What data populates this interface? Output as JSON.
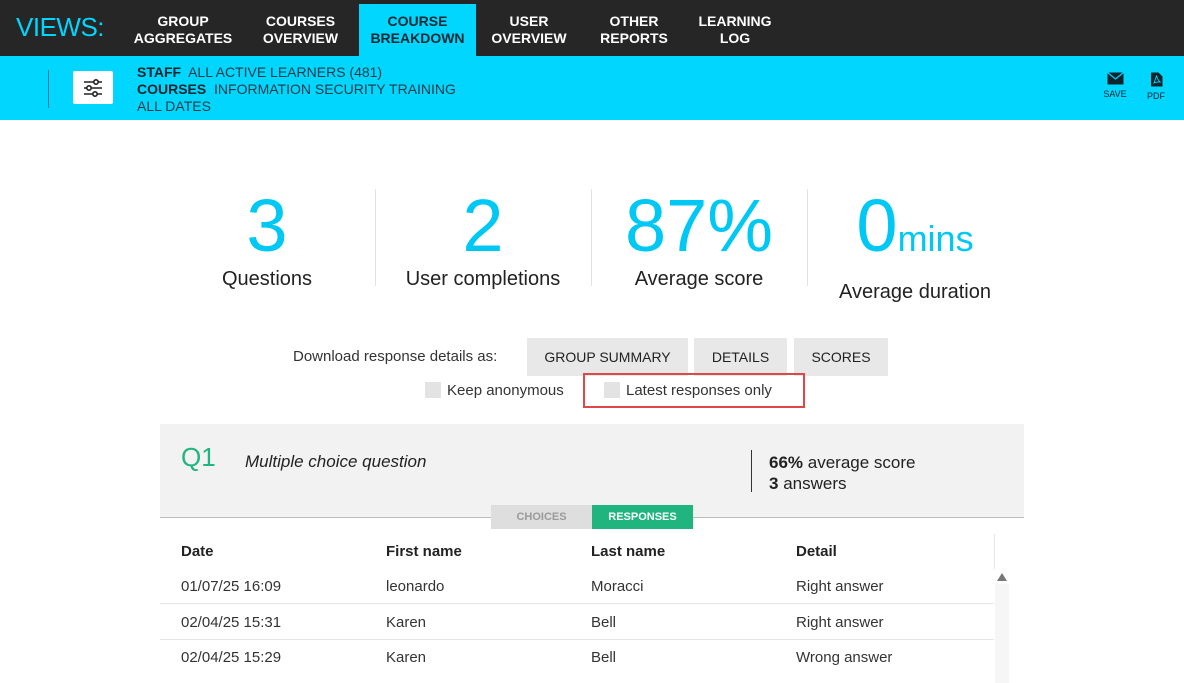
{
  "nav": {
    "views_label": "VIEWS:",
    "items": [
      {
        "line1": "GROUP",
        "line2": "AGGREGATES"
      },
      {
        "line1": "COURSES",
        "line2": "OVERVIEW"
      },
      {
        "line1": "COURSE",
        "line2": "BREAKDOWN"
      },
      {
        "line1": "USER",
        "line2": "OVERVIEW"
      },
      {
        "line1": "OTHER",
        "line2": "REPORTS"
      },
      {
        "line1": "LEARNING",
        "line2": "LOG"
      }
    ],
    "active_index": 2
  },
  "filters": {
    "staff_key": "STAFF",
    "staff_value": "ALL ACTIVE LEARNERS (481)",
    "courses_key": "COURSES",
    "courses_value": "INFORMATION SECURITY TRAINING",
    "dates_value": "ALL DATES",
    "save_label": "SAVE",
    "pdf_label": "PDF",
    "filter_icon": "sliders-icon",
    "save_icon": "envelope-icon",
    "pdf_icon": "pdf-file-icon"
  },
  "stats": [
    {
      "value": "3",
      "unit": "",
      "label": "Questions"
    },
    {
      "value": "2",
      "unit": "",
      "label": "User completions"
    },
    {
      "value": "87%",
      "unit": "",
      "label": "Average score"
    },
    {
      "value": "0",
      "unit": "mins",
      "label": "Average duration"
    }
  ],
  "download": {
    "label": "Download response details as:",
    "buttons": [
      "GROUP SUMMARY",
      "DETAILS",
      "SCORES"
    ],
    "keep_anonymous": "Keep anonymous",
    "latest_only": "Latest responses only"
  },
  "question": {
    "number": "Q1",
    "type": "Multiple choice question",
    "avg_score_value": "66%",
    "avg_score_text": "average score",
    "answers_value": "3",
    "answers_text": "answers",
    "tabs": [
      "CHOICES",
      "RESPONSES"
    ],
    "active_tab": "RESPONSES"
  },
  "table": {
    "columns": [
      "Date",
      "First name",
      "Last name",
      "Detail"
    ],
    "rows": [
      [
        "01/07/25 16:09",
        "leonardo",
        "Moracci",
        "Right answer"
      ],
      [
        "02/04/25 15:31",
        "Karen",
        "Bell",
        "Right answer"
      ],
      [
        "02/04/25 15:29",
        "Karen",
        "Bell",
        "Wrong answer"
      ]
    ]
  },
  "colors": {
    "accent": "#00d6ff",
    "nav_bg": "#262626",
    "stat": "#00c8f5",
    "green": "#20b57e",
    "highlight": "#e04848"
  }
}
